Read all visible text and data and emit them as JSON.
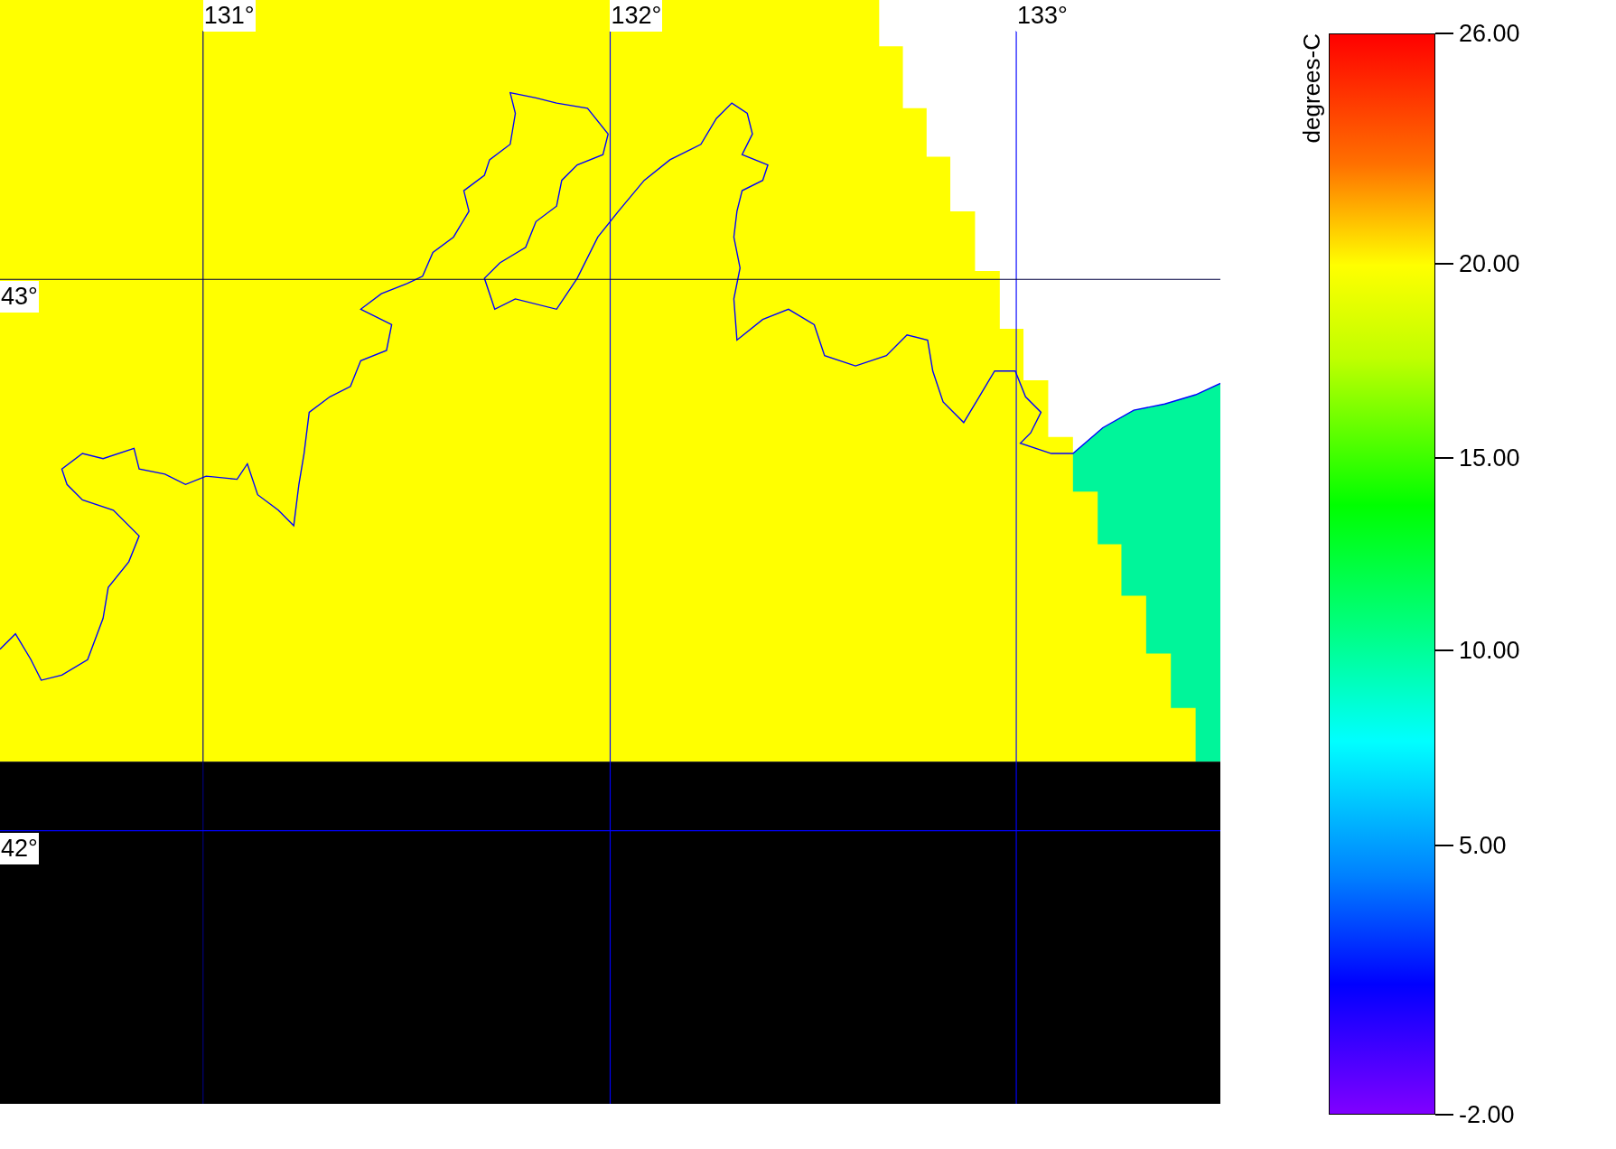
{
  "map": {
    "longitude_labels": [
      "131°",
      "132°",
      "133°"
    ],
    "latitude_labels": [
      "43°",
      "42°"
    ]
  },
  "legend": {
    "title": "degrees-C",
    "ticks": [
      "26.00",
      "20.00",
      "15.00",
      "10.00",
      "5.00",
      "-2.00"
    ]
  }
}
